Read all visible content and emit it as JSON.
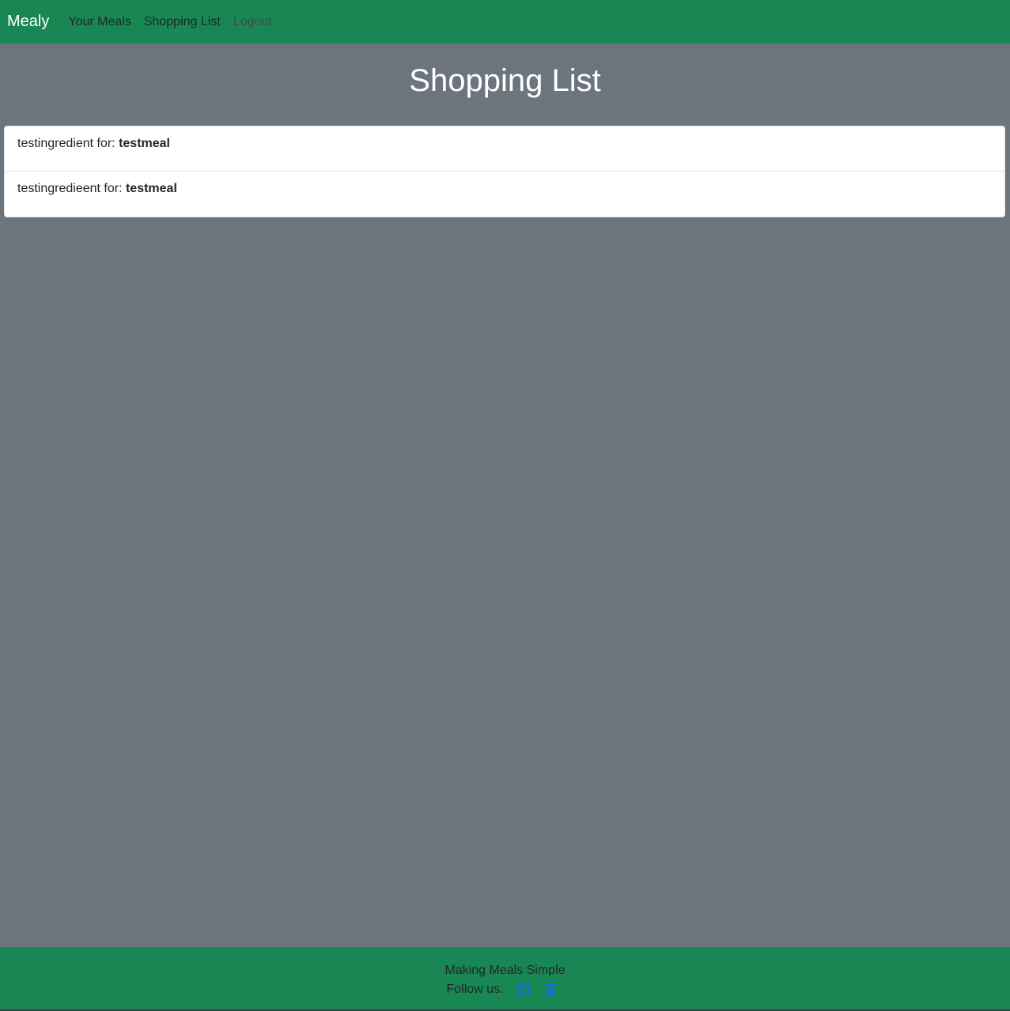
{
  "navbar": {
    "brand": "Mealy",
    "links": [
      {
        "label": "Your Meals"
      },
      {
        "label": "Shopping List"
      },
      {
        "label": "Logout"
      }
    ]
  },
  "page": {
    "title": "Shopping List"
  },
  "shopping_list": {
    "items": [
      {
        "ingredient": "testingredient for: ",
        "meal": "testmeal"
      },
      {
        "ingredient": "testingredieent for: ",
        "meal": "testmeal"
      }
    ]
  },
  "footer": {
    "tagline": "Making Meals Simple",
    "follow_label": "Follow us:",
    "social_icons": [
      "facebook-icon",
      "linkedin-icon"
    ]
  },
  "colors": {
    "navbar_bg": "#198754",
    "page_bg": "#6c757d",
    "social_icon": "#0d6efd"
  }
}
